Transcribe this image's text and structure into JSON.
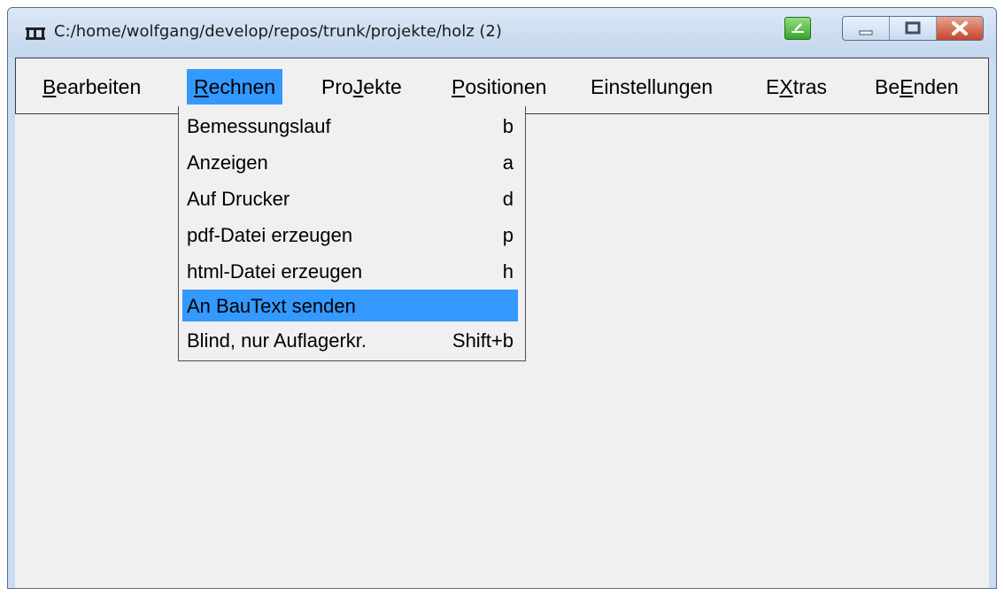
{
  "window": {
    "title": "C:/home/wolfgang/develop/repos/trunk/projekte/holz (2)",
    "app_icon": "bridge-app-icon",
    "colors": {
      "frame": "#c9dcf1",
      "client": "#f0f0f0",
      "highlight": "#3399ff"
    }
  },
  "menubar": {
    "items": [
      {
        "pre": "",
        "ul": "B",
        "post": "earbeiten"
      },
      {
        "pre": "",
        "ul": "R",
        "post": "echnen"
      },
      {
        "pre": "Pro",
        "ul": "J",
        "post": "ekte"
      },
      {
        "pre": "",
        "ul": "P",
        "post": "ositionen"
      },
      {
        "pre": "",
        "ul": "",
        "post": "Einstellungen"
      },
      {
        "pre": "E",
        "ul": "X",
        "post": "tras"
      },
      {
        "pre": "Be",
        "ul": "E",
        "post": "nden"
      }
    ],
    "active_index": 1
  },
  "dropdown": {
    "items": [
      {
        "label": "Bemessungslauf",
        "shortcut": "b"
      },
      {
        "label": "Anzeigen",
        "shortcut": "a"
      },
      {
        "label": "Auf Drucker",
        "shortcut": "d"
      },
      {
        "label": "pdf-Datei erzeugen",
        "shortcut": "p"
      },
      {
        "label": "html-Datei erzeugen",
        "shortcut": "h"
      },
      {
        "label": "An BauText senden",
        "shortcut": ""
      },
      {
        "label": "Blind, nur Auflagerkr.",
        "shortcut": "Shift+b"
      }
    ],
    "highlighted_index": 5
  }
}
